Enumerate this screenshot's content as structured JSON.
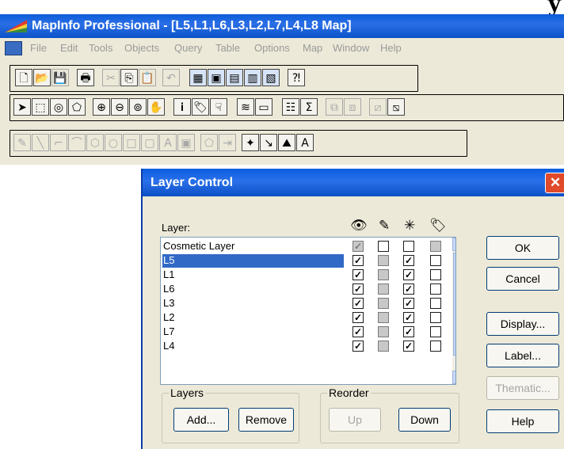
{
  "app": {
    "title": "MapInfo Professional - [L5,L1,L6,L3,L2,L7,L4,L8 Map]",
    "top_caption_fragment": "y"
  },
  "menu": [
    "File",
    "Edit",
    "Tools",
    "Objects",
    "Query",
    "Table",
    "Options",
    "Map",
    "Window",
    "Help"
  ],
  "dialog": {
    "title": "Layer Control",
    "close_glyph": "✕",
    "layer_label": "Layer:",
    "header_icons": [
      "visible-eye-icon",
      "editable-pencil-icon",
      "selectable-arrow-icon",
      "autolabel-tag-icon"
    ],
    "layers": [
      {
        "name": "Cosmetic Layer",
        "visible": true,
        "editable": false,
        "selectable": false,
        "autolabel": false,
        "selected": false,
        "visible_grey": true,
        "autolabel_grey": true
      },
      {
        "name": "L5",
        "visible": true,
        "editable": false,
        "selectable": true,
        "autolabel": false,
        "selected": true
      },
      {
        "name": "L1",
        "visible": true,
        "editable": false,
        "selectable": true,
        "autolabel": false,
        "selected": false
      },
      {
        "name": "L6",
        "visible": true,
        "editable": false,
        "selectable": true,
        "autolabel": false,
        "selected": false
      },
      {
        "name": "L3",
        "visible": true,
        "editable": false,
        "selectable": true,
        "autolabel": false,
        "selected": false
      },
      {
        "name": "L2",
        "visible": true,
        "editable": false,
        "selectable": true,
        "autolabel": false,
        "selected": false
      },
      {
        "name": "L7",
        "visible": true,
        "editable": false,
        "selectable": true,
        "autolabel": false,
        "selected": false
      },
      {
        "name": "L4",
        "visible": true,
        "editable": false,
        "selectable": true,
        "autolabel": false,
        "selected": false
      }
    ],
    "buttons": {
      "ok": "OK",
      "cancel": "Cancel",
      "display": "Display...",
      "label": "Label...",
      "thematic": "Thematic...",
      "help": "Help",
      "add": "Add...",
      "remove": "Remove",
      "up": "Up",
      "down": "Down"
    },
    "groups": {
      "layers": "Layers",
      "reorder": "Reorder"
    }
  },
  "colors": {
    "titlebar": "#0a5bd8",
    "selection": "#3169c6",
    "dialog_bg": "#ece9d8"
  }
}
